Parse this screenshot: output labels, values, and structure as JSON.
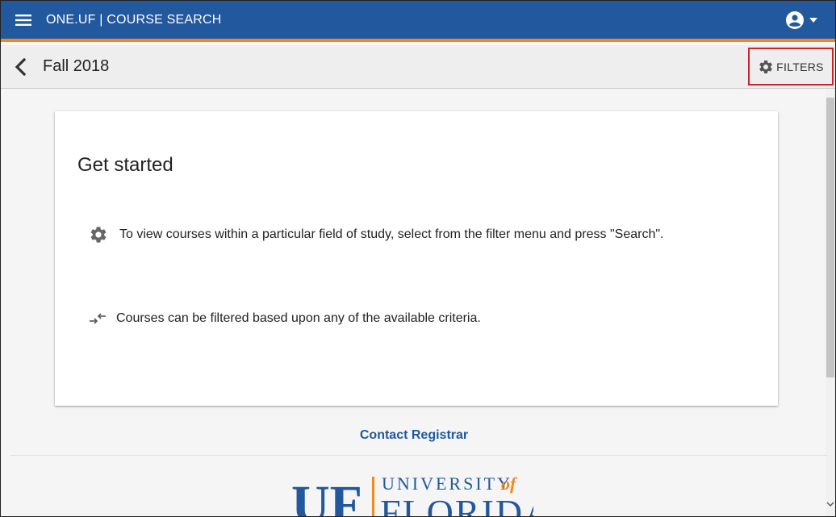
{
  "topbar": {
    "title": "ONE.UF | COURSE SEARCH",
    "menu_icon": "hamburger-menu-icon",
    "account_icon": "account-circle-icon",
    "caret_icon": "caret-down-icon",
    "bg_color": "#22589d",
    "accent_color": "#f08a1c"
  },
  "subheader": {
    "term": "Fall 2018",
    "back_icon": "chevron-left-icon",
    "filters_label": "FILTERS",
    "filters_icon": "gear-icon"
  },
  "card": {
    "title": "Get started",
    "items": [
      {
        "icon": "gear-icon",
        "text": "To view courses within a particular field of study, select from the filter menu and press \"Search\"."
      },
      {
        "icon": "compare-arrows-icon",
        "text": "Courses can be filtered based upon any of the available criteria."
      }
    ]
  },
  "footer": {
    "contact_link": "Contact Registrar",
    "logo_uf": "UF",
    "logo_university": "UNIVERSITY",
    "logo_of": "of",
    "logo_florida": "FLORIDA"
  },
  "colors": {
    "brand_blue": "#22589d",
    "brand_orange": "#f08a1c",
    "highlight_red": "#c8262b"
  }
}
